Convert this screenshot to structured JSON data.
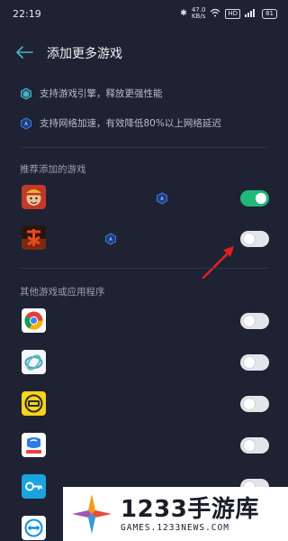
{
  "status_bar": {
    "time": "22:19",
    "network_speed": "47.0",
    "network_unit": "KB/s",
    "hd_label": "HD",
    "signal_label": "5G",
    "battery": "81"
  },
  "header": {
    "title": "添加更多游戏"
  },
  "features": [
    {
      "icon": "cube-icon",
      "text": "支持游戏引擎，释放更强性能"
    },
    {
      "icon": "boost-icon",
      "text": "支持网络加速，有效降低80%以上网络延迟"
    }
  ],
  "recommended": {
    "label": "推荐添加的游戏",
    "apps": [
      {
        "icon": "onepiece-game-icon",
        "toggle_on": true,
        "boost": true
      },
      {
        "icon": "wuxia-game-icon",
        "toggle_on": false,
        "boost": true
      }
    ]
  },
  "others": {
    "label": "其他游戏或应用程序",
    "apps": [
      {
        "icon": "chrome-icon",
        "toggle_on": false
      },
      {
        "icon": "cloud-app-icon",
        "toggle_on": false
      },
      {
        "icon": "gif-app-icon",
        "toggle_on": false
      },
      {
        "icon": "qq-mail-icon",
        "toggle_on": false
      },
      {
        "icon": "key-app-icon",
        "toggle_on": false
      },
      {
        "icon": "teamviewer-icon",
        "toggle_on": false
      }
    ]
  },
  "watermark": {
    "title": "1233手游库",
    "url": "GAMES.1233NEWS.COM"
  },
  "colors": {
    "background": "#1e2233",
    "toggle_on": "#21b87a",
    "accent": "#4a9ad6",
    "arrow": "#e02020"
  }
}
